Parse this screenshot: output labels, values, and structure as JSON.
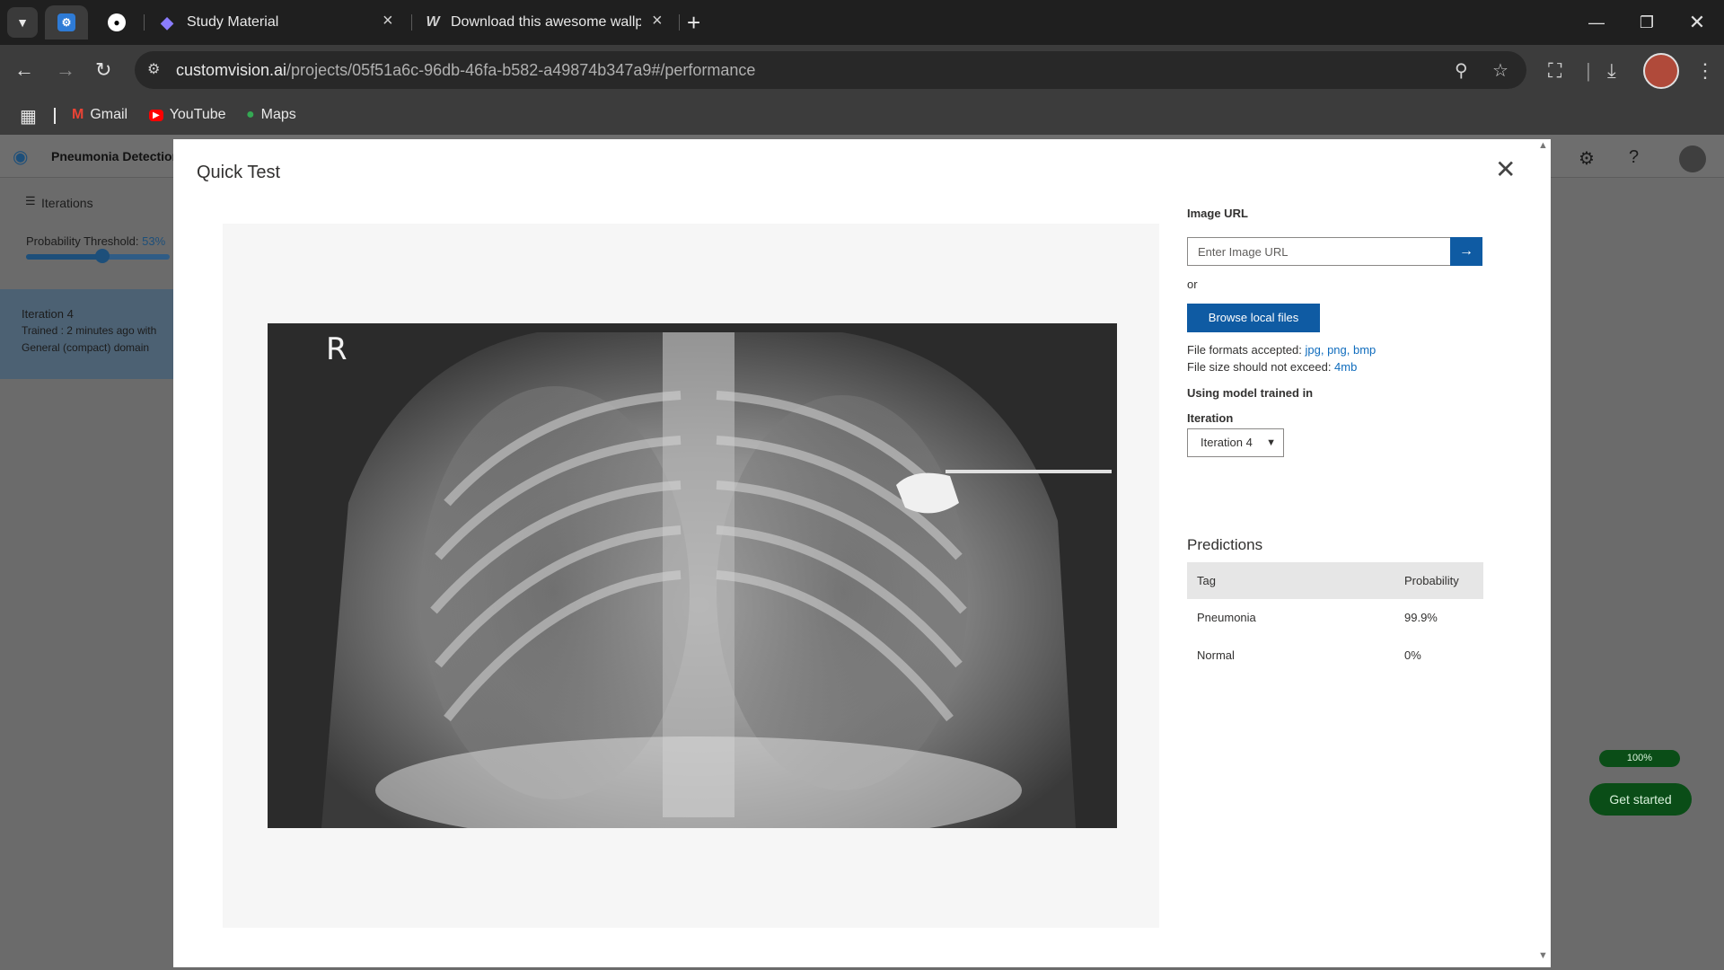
{
  "browser": {
    "tabs": [
      {
        "title": ""
      },
      {
        "title": ""
      },
      {
        "title": "Study Material"
      },
      {
        "title": "Download this awesome wallpa"
      }
    ],
    "url_host": "customvision.ai",
    "url_path": "/projects/05f51a6c-96db-46fa-b582-a49874b347a9#/performance",
    "bookmarks": [
      {
        "label": "Gmail"
      },
      {
        "label": "YouTube"
      },
      {
        "label": "Maps"
      }
    ]
  },
  "page": {
    "project_name": "Pneumonia Detection",
    "iterations_label": "Iterations",
    "threshold_label": "Probability Threshold:",
    "threshold_value": "53%",
    "threshold_fraction": 0.53,
    "iteration_card": {
      "title": "Iteration 4",
      "line1": "Trained : 2 minutes ago with",
      "line2": "General (compact) domain"
    },
    "progress_label": "100%",
    "get_started_label": "Get started"
  },
  "modal": {
    "title": "Quick Test",
    "xray_marker": "R",
    "image_url_label": "Image URL",
    "image_url_placeholder": "Enter Image URL",
    "or_label": "or",
    "browse_label": "Browse local files",
    "formats_prefix": "File formats accepted: ",
    "formats_value": "jpg, png, bmp",
    "size_prefix": "File size should not exceed: ",
    "size_value": "4mb",
    "model_label": "Using model trained in",
    "iteration_label": "Iteration",
    "iteration_selected": "Iteration 4",
    "predictions_title": "Predictions",
    "table_headers": {
      "tag": "Tag",
      "probability": "Probability"
    },
    "predictions": [
      {
        "tag": "Pneumonia",
        "probability": "99.9%"
      },
      {
        "tag": "Normal",
        "probability": "0%"
      }
    ]
  },
  "colors": {
    "accent": "#0f5ba3",
    "link": "#0f6cbd",
    "success": "#0a4d17"
  }
}
